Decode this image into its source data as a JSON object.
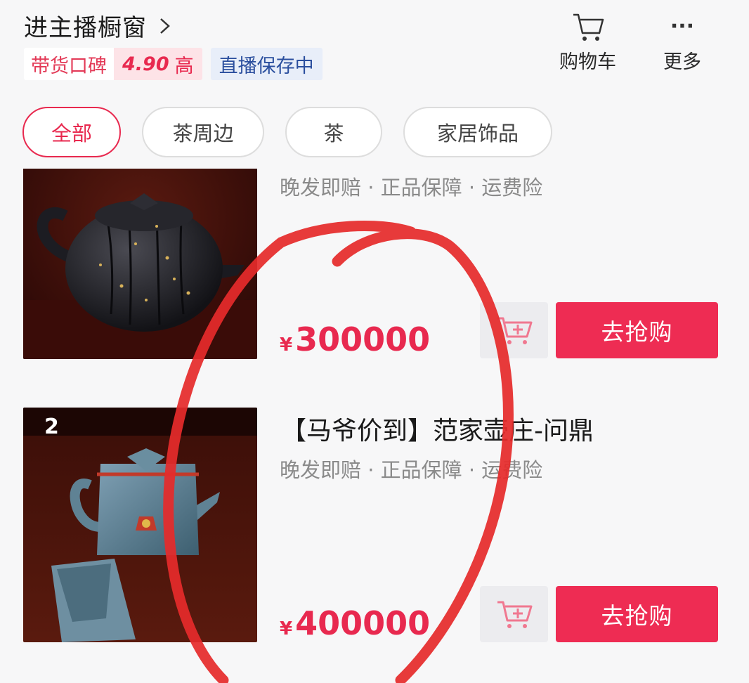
{
  "header": {
    "title": "进主播橱窗",
    "reputation_label": "带货口碑",
    "reputation_score": "4.90",
    "reputation_level": "高",
    "live_status": "直播保存中",
    "cart_label": "购物车",
    "more_label": "更多",
    "more_icon": "···"
  },
  "categories": [
    {
      "label": "全部",
      "active": true
    },
    {
      "label": "茶周边",
      "active": false
    },
    {
      "label": "茶",
      "active": false
    },
    {
      "label": "家居饰品",
      "active": false
    }
  ],
  "products": [
    {
      "guarantee": "晚发即赔 · 正品保障 · 运费险",
      "currency": "¥",
      "price": "300000",
      "buy_label": "去抢购"
    },
    {
      "rank": "2",
      "name": "【马爷价到】范家壶庄-问鼎",
      "guarantee": "晚发即赔 · 正品保障 · 运费险",
      "currency": "¥",
      "price": "400000",
      "buy_label": "去抢购"
    }
  ],
  "colors": {
    "accent": "#ee2c53",
    "annotation": "#e52b2b"
  }
}
